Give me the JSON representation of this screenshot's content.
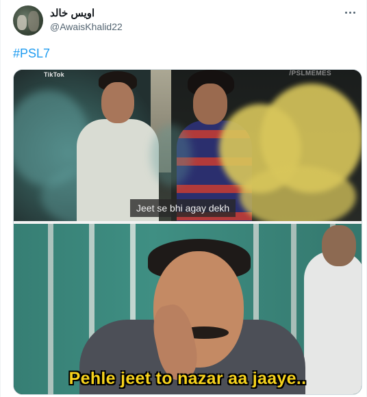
{
  "tweet": {
    "display_name": "اویس خالد",
    "handle": "@AwaisKhalid22",
    "hashtag": "#PSL7",
    "more_icon": "more-horizontal-icon"
  },
  "media": {
    "frame_top": {
      "source_logo": "TikTok",
      "watermark": "/PSLMEMES",
      "subtitle": "Jeet se bhi agay dekh"
    },
    "frame_bottom": {
      "caption": "Pehle jeet to nazar aa jaaye.."
    }
  },
  "colors": {
    "link": "#1d9bf0",
    "name": "#0f1419",
    "secondary": "#536471",
    "caption": "#f6d21c"
  }
}
